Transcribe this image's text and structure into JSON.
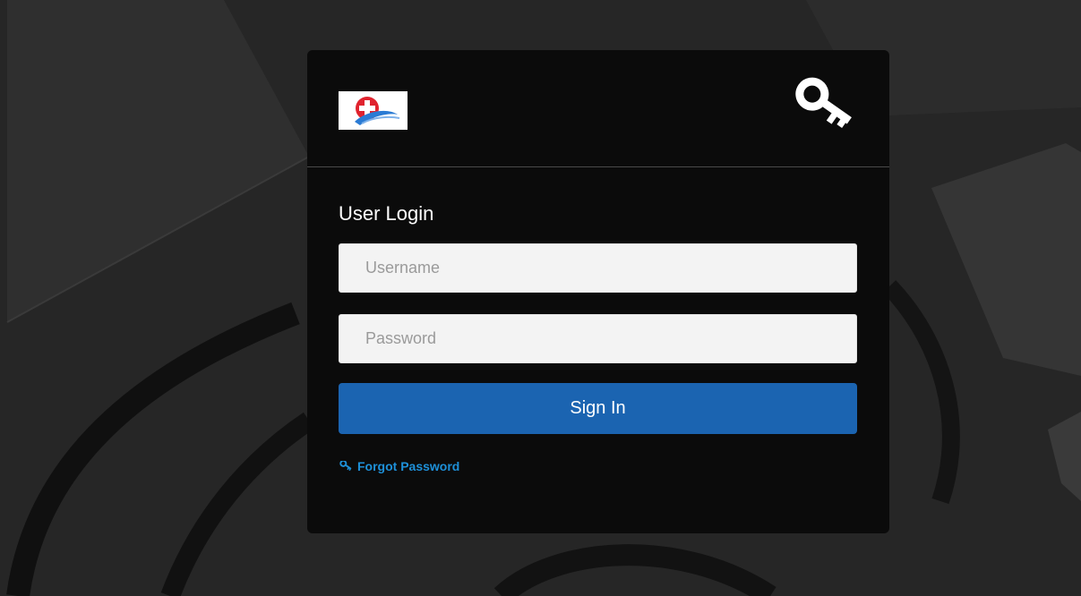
{
  "login": {
    "title": "User Login",
    "username_placeholder": "Username",
    "password_placeholder": "Password",
    "signin_label": "Sign In",
    "forgot_label": "Forgot Password"
  },
  "icons": {
    "header": "key-icon",
    "forgot": "key-icon",
    "logo": "medical-cross-logo"
  },
  "colors": {
    "primary_button": "#1b64b1",
    "link": "#1e90d8",
    "card_background": "#0b0b0b",
    "logo_red": "#e0232e",
    "logo_blue": "#2a7bd4"
  }
}
